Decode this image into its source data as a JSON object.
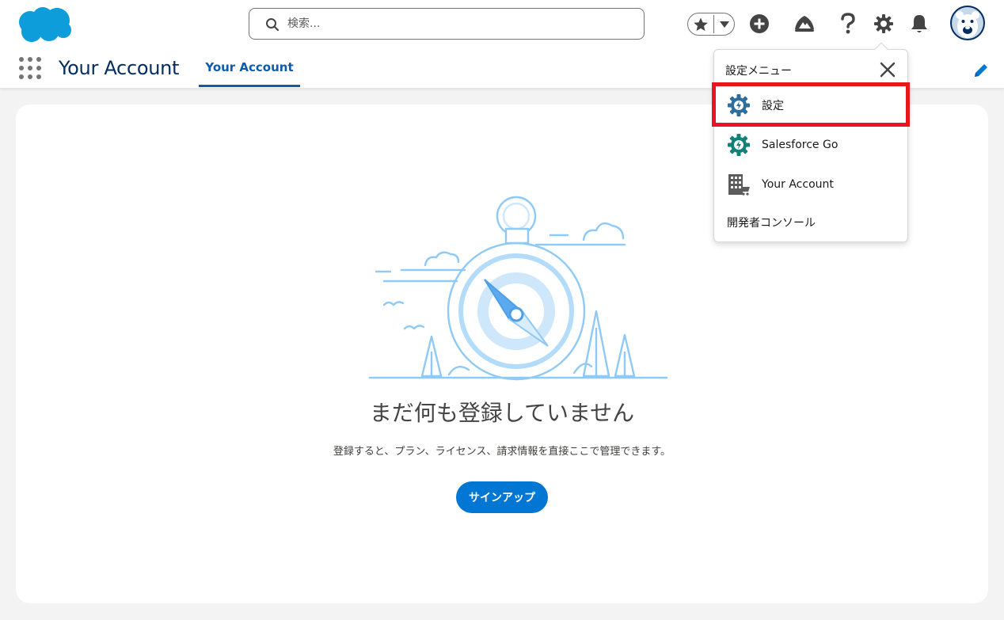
{
  "header": {
    "logo_name": "salesforce-cloud-logo",
    "search": {
      "placeholder": "検索..."
    },
    "icons": [
      "star-icon",
      "chevron-down-icon",
      "add-icon",
      "trailhead-icon",
      "help-icon",
      "gear-icon",
      "bell-icon",
      "avatar"
    ]
  },
  "nav": {
    "app_name": "Your Account",
    "tabs": [
      {
        "label": "Your Account",
        "active": true
      }
    ]
  },
  "main": {
    "empty_title": "まだ何も登録していません",
    "empty_subtitle": "登録すると、プラン、ライセンス、請求情報を直接ここで管理できます。",
    "signup_label": "サインアップ"
  },
  "setup_menu": {
    "title": "設定メニュー",
    "items": [
      {
        "label": "設定",
        "icon": "setup-gear-icon",
        "highlighted": true
      },
      {
        "label": "Salesforce Go",
        "icon": "salesforce-go-icon"
      },
      {
        "label": "Your Account",
        "icon": "building-icon"
      },
      {
        "label": "開発者コンソール",
        "icon": ""
      }
    ]
  },
  "colors": {
    "brand_blue": "#0176d3",
    "nav_text": "#032d60",
    "active_tab": "#0b5cab",
    "highlight": "#e8151f",
    "illustration": "#8fc9f5"
  }
}
